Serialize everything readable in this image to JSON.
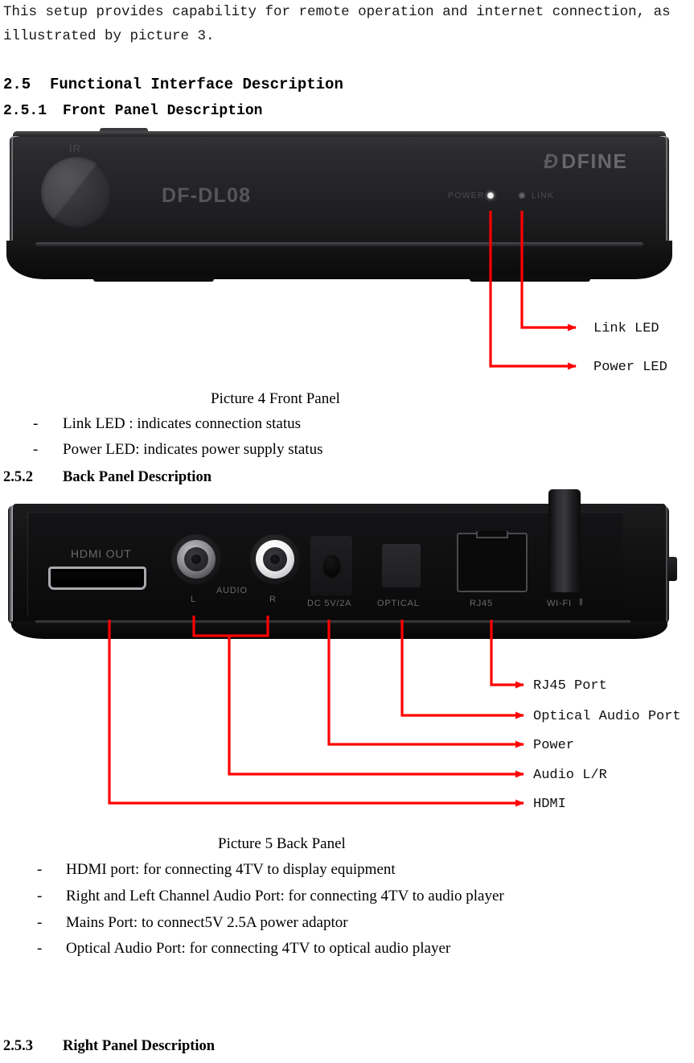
{
  "document": {
    "intro_paragraph": "This setup provides capability for remote operation and internet connection, as\nillustrated by picture 3.",
    "section_2_5": {
      "number": "2.5",
      "title": "Functional Interface Description"
    },
    "section_2_5_1": {
      "number": "2.5.1",
      "title": "Front Panel Description"
    },
    "section_2_5_2": {
      "number": "2.5.2",
      "title": "Back Panel Description"
    },
    "section_2_5_3": {
      "number": "2.5.3",
      "title": "Right Panel Description"
    }
  },
  "front_panel": {
    "device": {
      "ir_label": "IR",
      "model_name": "DF-DL08",
      "brand_mark": "Ð",
      "brand_name": "DFINE",
      "power_indicator_label": "POWER",
      "link_indicator_label": "LINK"
    },
    "callouts": [
      {
        "id": "link-led",
        "label": "Link LED"
      },
      {
        "id": "power-led",
        "label": "Power LED"
      }
    ],
    "caption": "Picture 4 Front Panel",
    "bullets": [
      {
        "marker": "-",
        "text": "Link LED : indicates connection status"
      },
      {
        "marker": "-",
        "text": "Power LED: indicates power supply status"
      }
    ]
  },
  "back_panel": {
    "device": {
      "ports": [
        {
          "id": "hdmi",
          "label": "HDMI OUT"
        },
        {
          "id": "audio-l",
          "label": "L"
        },
        {
          "id": "audio",
          "label": "AUDIO"
        },
        {
          "id": "audio-r",
          "label": "R"
        },
        {
          "id": "dc",
          "label": "DC 5V/2A"
        },
        {
          "id": "optical",
          "label": "OPTICAL"
        },
        {
          "id": "rj45",
          "label": "RJ45"
        },
        {
          "id": "wifi",
          "label": "WI-FI"
        }
      ],
      "wifi_icon": "⦀"
    },
    "callouts": [
      {
        "id": "rj45",
        "label": "RJ45 Port"
      },
      {
        "id": "optical",
        "label": "Optical Audio Port"
      },
      {
        "id": "power",
        "label": "Power"
      },
      {
        "id": "audio-lr",
        "label": "Audio L/R"
      },
      {
        "id": "hdmi",
        "label": "HDMI"
      }
    ],
    "caption": "Picture 5 Back Panel",
    "bullets": [
      {
        "marker": "-",
        "text": "HDMI port: for connecting 4TV to display equipment"
      },
      {
        "marker": "-",
        "text": "Right and Left Channel Audio Port: for connecting 4TV to audio player"
      },
      {
        "marker": "-",
        "text": "Mains Port: to connect5V 2.5A power adaptor"
      },
      {
        "marker": "-",
        "text": "Optical Audio Port: for connecting 4TV to optical audio player"
      }
    ]
  },
  "colors": {
    "leader_red": "#FF0000",
    "text_black": "#000000",
    "device_body": "#1d1d1f"
  }
}
